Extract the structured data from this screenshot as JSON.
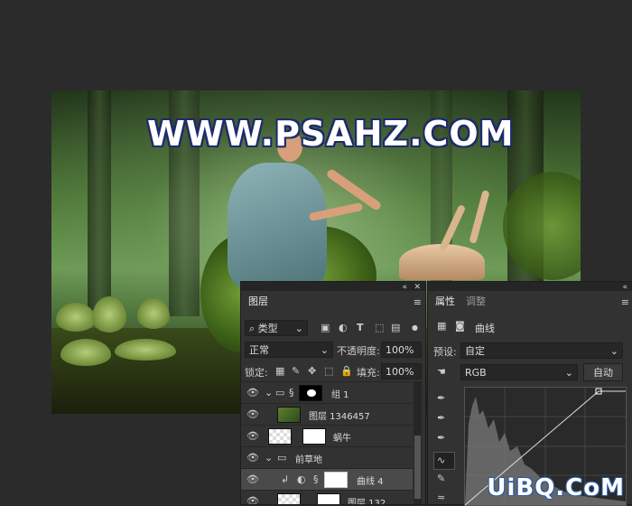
{
  "canvas": {
    "watermark": "WWW.PSAHZ.COM"
  },
  "layers_panel": {
    "tab_label": "图层",
    "filter_kind": "类型",
    "blend_mode": "正常",
    "opacity_label": "不透明度:",
    "opacity_value": "100%",
    "lock_label": "锁定:",
    "fill_label": "填充:",
    "fill_value": "100%",
    "layers": [
      {
        "name": "组 1",
        "type": "group"
      },
      {
        "name": "图层 1346457",
        "type": "layer"
      },
      {
        "name": "蜗牛",
        "type": "layer"
      },
      {
        "name": "前草地",
        "type": "group"
      },
      {
        "name": "曲线 4",
        "type": "adjustment"
      },
      {
        "name": "图层 132",
        "type": "layer"
      }
    ]
  },
  "properties_panel": {
    "tabs": [
      "属性",
      "调整"
    ],
    "adjustment_title": "曲线",
    "preset_label": "预设:",
    "preset_value": "自定",
    "channel_value": "RGB",
    "auto_button": "自动"
  },
  "credit": "UiBQ.CoM"
}
